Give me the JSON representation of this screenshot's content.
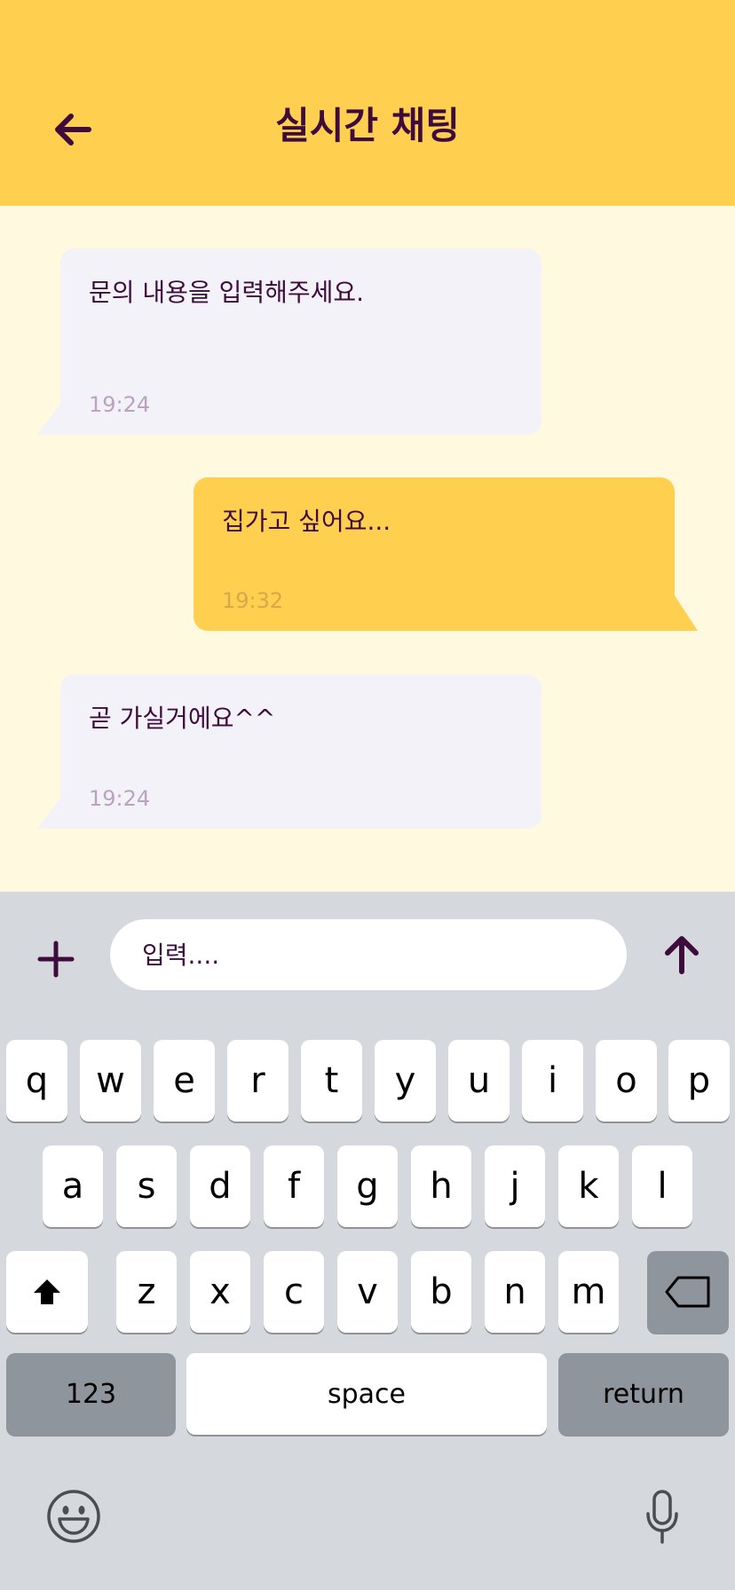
{
  "header": {
    "title": "실시간 채팅"
  },
  "messages": [
    {
      "direction": "in",
      "text": "문의 내용을 입력해주세요.",
      "time": "19:24"
    },
    {
      "direction": "out",
      "text": "집가고 싶어요...",
      "time": "19:32"
    },
    {
      "direction": "in",
      "text": "곧 가실거에요^^",
      "time": "19:24"
    }
  ],
  "composer": {
    "placeholder": "입력...."
  },
  "keyboard": {
    "row1": [
      "q",
      "w",
      "e",
      "r",
      "t",
      "y",
      "u",
      "i",
      "o",
      "p"
    ],
    "row2": [
      "a",
      "s",
      "d",
      "f",
      "g",
      "h",
      "j",
      "k",
      "l"
    ],
    "row3": [
      "z",
      "x",
      "c",
      "v",
      "b",
      "n",
      "m"
    ],
    "numbers_label": "123",
    "space_label": "space",
    "return_label": "return"
  },
  "colors": {
    "header_bg": "#FFD050",
    "chat_bg": "#FFF9E0",
    "incoming_bubble": "#F2F2F8",
    "outgoing_bubble": "#FFD050",
    "text": "#3D0C3D",
    "keyboard_bg": "#D5D8DC"
  },
  "icons": {
    "back": "arrow-left-icon",
    "attach": "plus-icon",
    "send": "arrow-up-icon",
    "shift": "shift-icon",
    "delete": "backspace-icon",
    "emoji": "emoji-icon",
    "mic": "microphone-icon"
  }
}
